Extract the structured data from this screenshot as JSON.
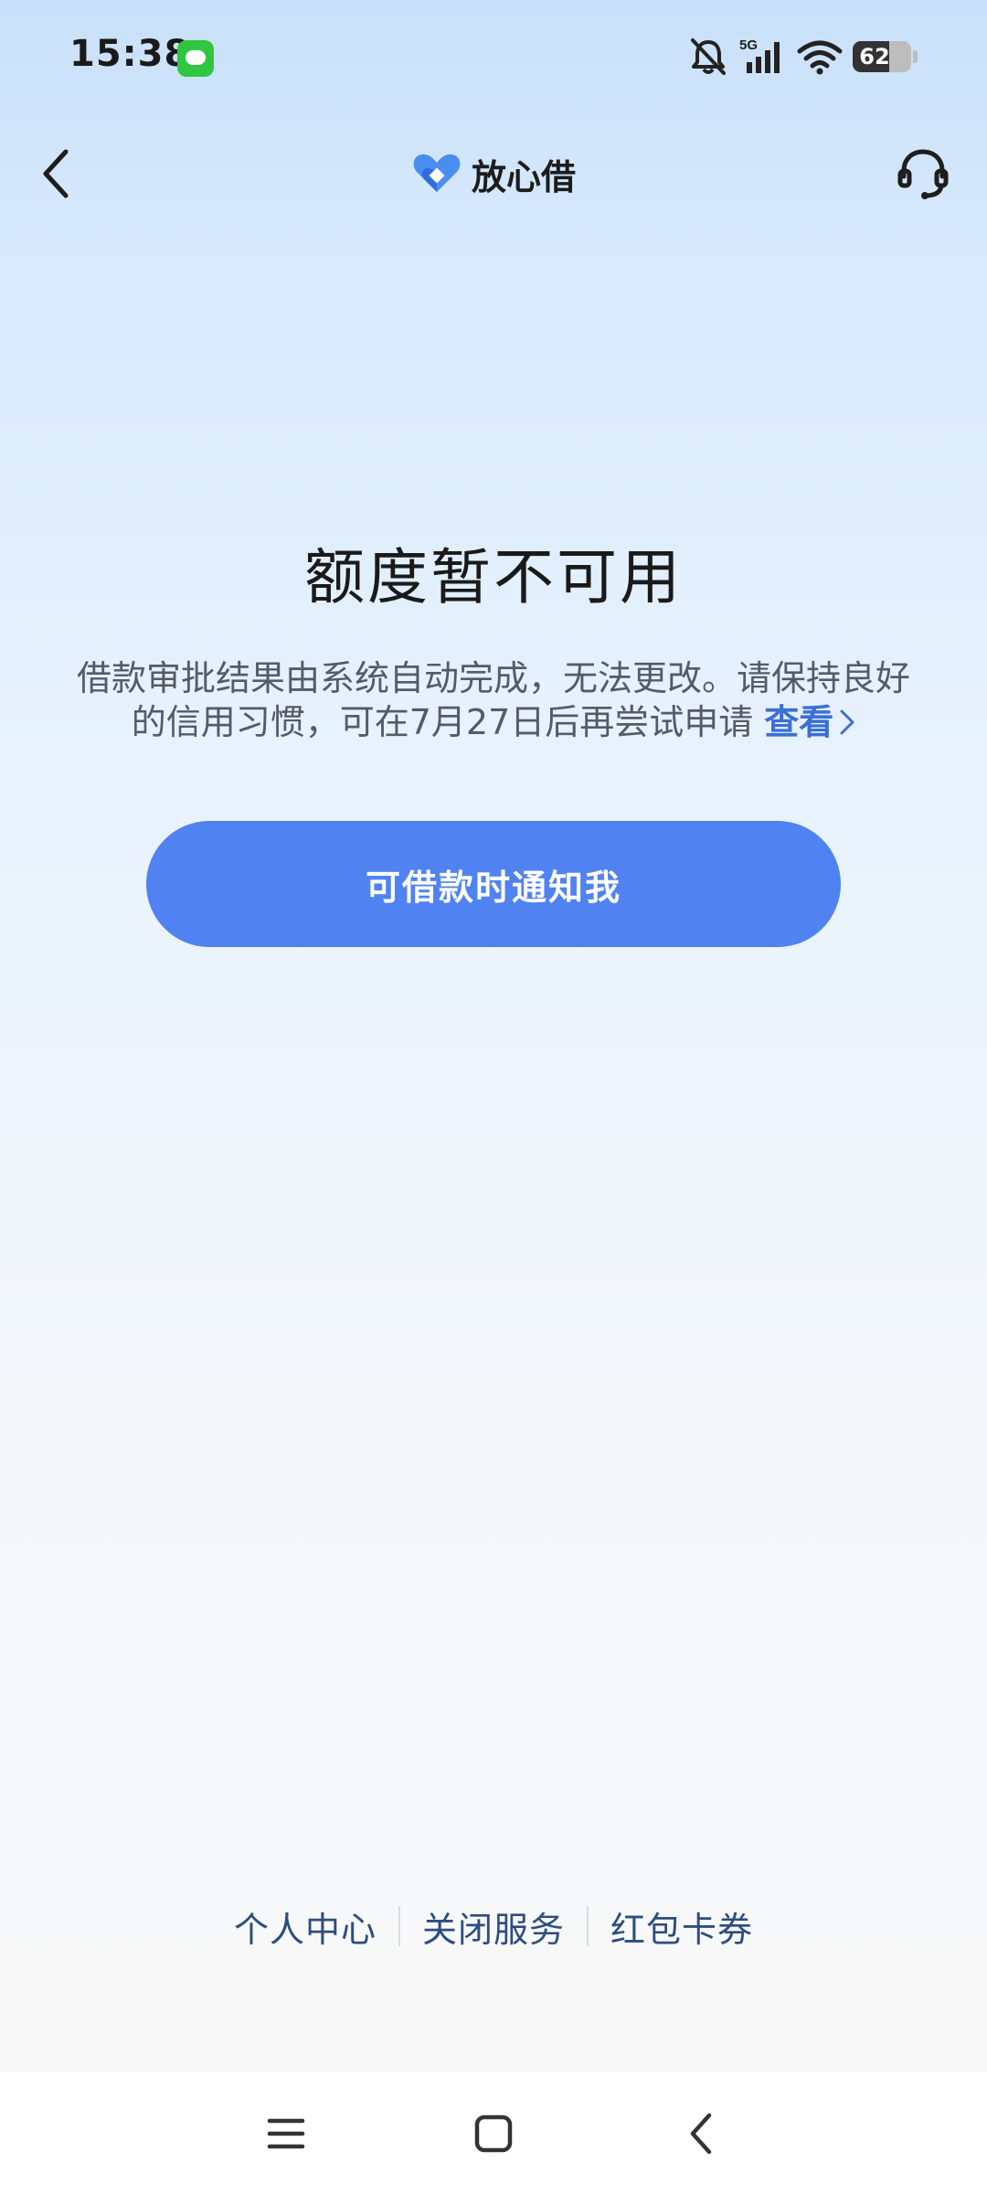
{
  "status_bar": {
    "time": "15:38",
    "network": "5G",
    "battery": "62",
    "battery_level": 0.62
  },
  "header": {
    "brand_name": "放心借",
    "icons": [
      "back-arrow-icon",
      "brand-logo-icon",
      "headset-icon"
    ]
  },
  "main": {
    "title": "额度暂不可用",
    "description_line1": "借款审批结果由系统自动完成，无法更改。请保持良好",
    "description_line2": "的信用习惯，可在7月27日后再尝试申请",
    "link_label": "查看",
    "button_label": "可借款时通知我"
  },
  "footer": {
    "links": [
      "个人中心",
      "关闭服务",
      "红包卡券"
    ]
  },
  "system_nav": {
    "icons": [
      "menu-icon",
      "home-icon",
      "back-icon"
    ]
  },
  "colors": {
    "accent": "#5182f2",
    "link": "#3b6fd8",
    "footer_link": "#2d4d7f"
  }
}
